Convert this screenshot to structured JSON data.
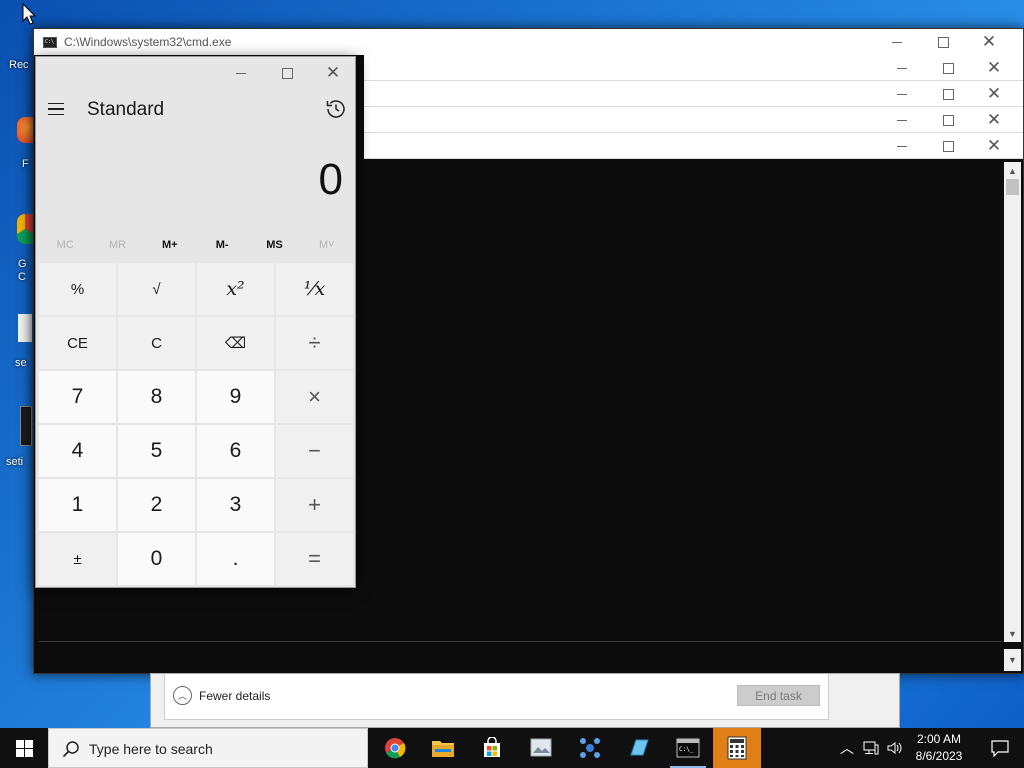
{
  "desktop": {
    "icons": [
      {
        "label": "Rec",
        "icon": "recycle-bin-icon"
      },
      {
        "label": "F",
        "icon": "firefox-shortcut-icon"
      },
      {
        "label": "G\nC",
        "icon": "chrome-shortcut-icon"
      },
      {
        "label": "se",
        "icon": "file-icon"
      },
      {
        "label": "seti",
        "icon": "file-icon"
      }
    ]
  },
  "cmd": {
    "title": "C:\\Windows\\system32\\cmd.exe",
    "stacked_windows": 4
  },
  "task_manager": {
    "fewer_details_label": "Fewer details",
    "end_task_label": "End task"
  },
  "calculator": {
    "mode": "Standard",
    "display": "0",
    "memory": [
      {
        "label": "MC",
        "enabled": false
      },
      {
        "label": "MR",
        "enabled": false
      },
      {
        "label": "M+",
        "enabled": true
      },
      {
        "label": "M-",
        "enabled": true
      },
      {
        "label": "MS",
        "enabled": true
      },
      {
        "label": "M˅",
        "enabled": false
      }
    ],
    "keys": [
      {
        "label": "%",
        "kind": "fn",
        "name": "percent-button"
      },
      {
        "label": "√",
        "kind": "fn",
        "name": "square-root-button"
      },
      {
        "label": "x²",
        "kind": "fn-it",
        "name": "square-button"
      },
      {
        "label": "¹⁄x",
        "kind": "fn-it",
        "name": "reciprocal-button"
      },
      {
        "label": "CE",
        "kind": "fn",
        "name": "clear-entry-button"
      },
      {
        "label": "C",
        "kind": "fn",
        "name": "clear-button"
      },
      {
        "label": "⌫",
        "kind": "fn",
        "name": "backspace-button"
      },
      {
        "label": "÷",
        "kind": "op",
        "name": "divide-button"
      },
      {
        "label": "7",
        "kind": "num",
        "name": "digit-7-button"
      },
      {
        "label": "8",
        "kind": "num",
        "name": "digit-8-button"
      },
      {
        "label": "9",
        "kind": "num",
        "name": "digit-9-button"
      },
      {
        "label": "×",
        "kind": "op",
        "name": "multiply-button"
      },
      {
        "label": "4",
        "kind": "num",
        "name": "digit-4-button"
      },
      {
        "label": "5",
        "kind": "num",
        "name": "digit-5-button"
      },
      {
        "label": "6",
        "kind": "num",
        "name": "digit-6-button"
      },
      {
        "label": "−",
        "kind": "op",
        "name": "minus-button"
      },
      {
        "label": "1",
        "kind": "num",
        "name": "digit-1-button"
      },
      {
        "label": "2",
        "kind": "num",
        "name": "digit-2-button"
      },
      {
        "label": "3",
        "kind": "num",
        "name": "digit-3-button"
      },
      {
        "label": "+",
        "kind": "op",
        "name": "plus-button"
      },
      {
        "label": "±",
        "kind": "fn",
        "name": "negate-button"
      },
      {
        "label": "0",
        "kind": "num",
        "name": "digit-0-button"
      },
      {
        "label": ".",
        "kind": "num",
        "name": "decimal-button"
      },
      {
        "label": "=",
        "kind": "op",
        "name": "equals-button"
      }
    ]
  },
  "taskbar": {
    "search_placeholder": "Type here to search",
    "apps": [
      {
        "name": "chrome-icon",
        "state": "none"
      },
      {
        "name": "file-explorer-icon",
        "state": "none"
      },
      {
        "name": "microsoft-store-icon",
        "state": "none"
      },
      {
        "name": "image-viewer-icon",
        "state": "none"
      },
      {
        "name": "network-app-icon",
        "state": "none"
      },
      {
        "name": "notepad-app-icon",
        "state": "none"
      },
      {
        "name": "command-prompt-icon",
        "state": "running"
      },
      {
        "name": "calculator-icon",
        "state": "active"
      }
    ],
    "time": "2:00 AM",
    "date": "8/6/2023"
  },
  "colors": {
    "taskbar_bg": "#101010",
    "active_app": "#e17e16",
    "desktop": "#1e7ad6"
  }
}
